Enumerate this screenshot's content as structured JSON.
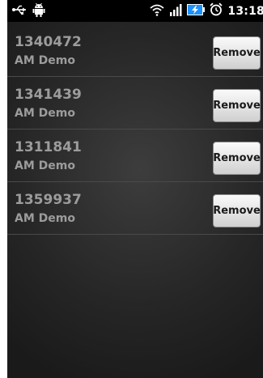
{
  "status_bar": {
    "time": "13:18",
    "icons": [
      "usb-icon",
      "android-debug-icon",
      "wifi-icon",
      "signal-icon",
      "battery-charging-icon",
      "alarm-icon"
    ]
  },
  "items": [
    {
      "id": "1340472",
      "subtitle": "AM Demo",
      "button_label": "Remove"
    },
    {
      "id": "1341439",
      "subtitle": "AM Demo",
      "button_label": "Remove"
    },
    {
      "id": "1311841",
      "subtitle": "AM Demo",
      "button_label": "Remove"
    },
    {
      "id": "1359937",
      "subtitle": "AM Demo",
      "button_label": "Remove"
    }
  ],
  "colors": {
    "background": "#262626",
    "text": "#9c9c9c",
    "statusbar": "#000000",
    "battery": "#1e90ff"
  }
}
